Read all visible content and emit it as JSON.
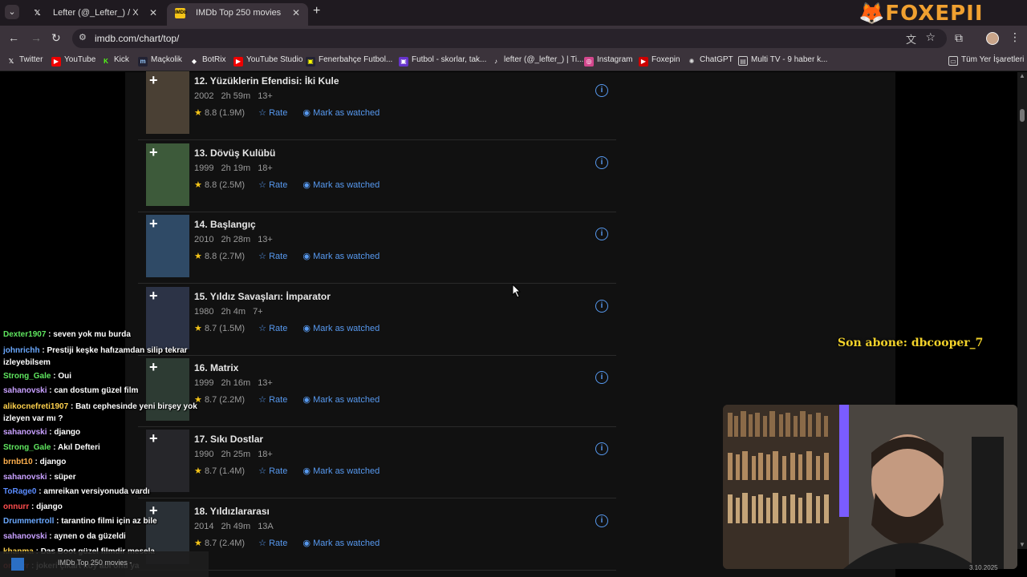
{
  "browser": {
    "tabs": [
      {
        "title": "Lefter (@_Lefter_) / X"
      },
      {
        "title": "IMDb Top 250 movies"
      }
    ],
    "url": "imdb.com/chart/top/",
    "bookmarks": [
      "Twitter",
      "YouTube",
      "Kick",
      "Maçkolik",
      "BotRix",
      "YouTube Studio",
      "Fenerbahçe Futbol...",
      "Futbol - skorlar, tak...",
      "lefter (@_lefter_) | Ti...",
      "Instagram",
      "Foxepin",
      "ChatGPT",
      "Multi TV - 9 haber k...",
      "Tüm Yer İşaretleri"
    ]
  },
  "movies": [
    {
      "title": "12. Yüzüklerin Efendisi: İki Kule",
      "year": "2002",
      "duration": "2h 59m",
      "rating_cert": "13+",
      "rating": "8.8 (1.9M)",
      "poster_color": "#4a4034"
    },
    {
      "title": "13. Dövüş Kulübü",
      "year": "1999",
      "duration": "2h 19m",
      "rating_cert": "18+",
      "rating": "8.8 (2.5M)",
      "poster_color": "#3d5a3a"
    },
    {
      "title": "14. Başlangıç",
      "year": "2010",
      "duration": "2h 28m",
      "rating_cert": "13+",
      "rating": "8.8 (2.7M)",
      "poster_color": "#2f4a66"
    },
    {
      "title": "15. Yıldız Savaşları: İmparator",
      "year": "1980",
      "duration": "2h 4m",
      "rating_cert": "7+",
      "rating": "8.7 (1.5M)",
      "poster_color": "#2c3346"
    },
    {
      "title": "16. Matrix",
      "year": "1999",
      "duration": "2h 16m",
      "rating_cert": "13+",
      "rating": "8.7 (2.2M)",
      "poster_color": "#2d3b33"
    },
    {
      "title": "17. Sıkı Dostlar",
      "year": "1990",
      "duration": "2h 25m",
      "rating_cert": "18+",
      "rating": "8.7 (1.4M)",
      "poster_color": "#26262a"
    },
    {
      "title": "18. Yıldızlararası",
      "year": "2014",
      "duration": "2h 49m",
      "rating_cert": "13A",
      "rating": "8.7 (2.4M)",
      "poster_color": "#2a3036"
    }
  ],
  "labels": {
    "rate": "Rate",
    "mark_watched": "Mark as watched",
    "add": "+",
    "info": "i"
  },
  "chat": [
    {
      "user": "Dexter1907",
      "color": "#5fe65f",
      "text": "seven yok mu burda"
    },
    {
      "user": "johnrichh",
      "color": "#6aa8ff",
      "text": "Prestiji keşke hafızamdan silip tekrar izleyebilsem",
      "wrap": true
    },
    {
      "user": "Strong_Gale",
      "color": "#5fe65f",
      "text": "Oui"
    },
    {
      "user": "sahanovski",
      "color": "#c8a0ff",
      "text": "can dostum güzel film"
    },
    {
      "user": "alikocnefreti1907",
      "color": "#ffd24d",
      "text": "Batı cephesinde yeni birşey yok izleyen var mı ?",
      "wrap": true
    },
    {
      "user": "sahanovski",
      "color": "#c8a0ff",
      "text": "django"
    },
    {
      "user": "Strong_Gale",
      "color": "#5fe65f",
      "text": "Akıl Defteri"
    },
    {
      "user": "brnbt10",
      "color": "#ffb04d",
      "text": "django"
    },
    {
      "user": "sahanovski",
      "color": "#c8a0ff",
      "text": "süper"
    },
    {
      "user": "ToRage0",
      "color": "#5a8cff",
      "text": "amreikan versiyonuda vardı"
    },
    {
      "user": "onnurr",
      "color": "#ff4d4d",
      "text": "django"
    },
    {
      "user": "Drummertroll",
      "color": "#6aa8ff",
      "text": "tarantino filmi için az bile"
    },
    {
      "user": "sahanovski",
      "color": "#c8a0ff",
      "text": "aynen o da güzeldi"
    },
    {
      "user": "khanma",
      "color": "#ffd24d",
      "text": "Das Boot güzel filmdir mesela"
    },
    {
      "user": "onnurr",
      "color": "#ff4d4d",
      "text": "jokeri çıkart koy abi onu ya"
    }
  ],
  "overlay": {
    "brand": "FOXEPII",
    "latest_subscriber": "Son abone: dbcooper_7",
    "taskbar_title": "IMDb Top 250 movies -",
    "date": "3.10.2025"
  },
  "colors": {
    "imdb_blue": "#5799ef",
    "imdb_yellow": "#f5c518"
  }
}
